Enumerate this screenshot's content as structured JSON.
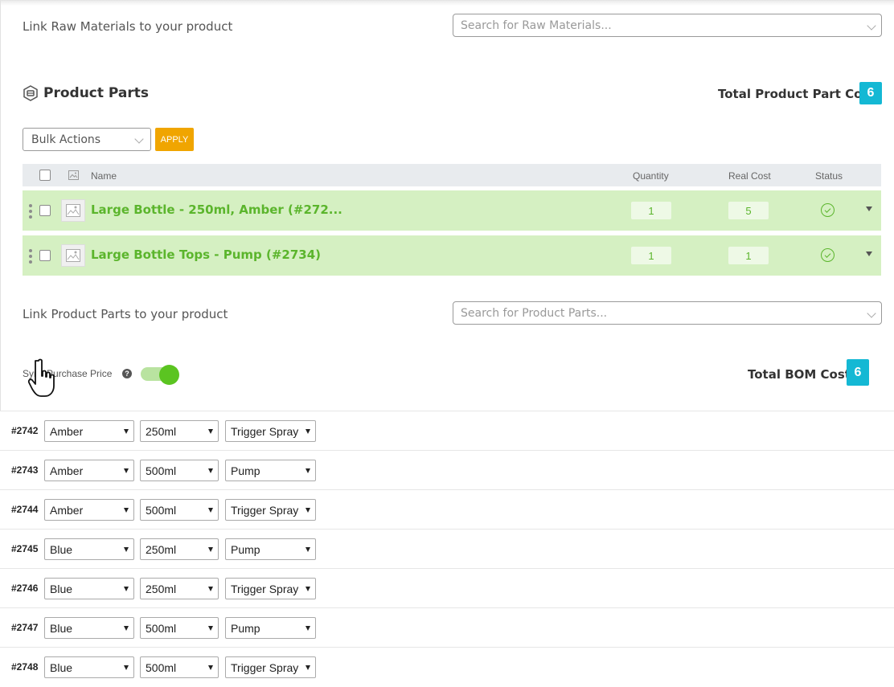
{
  "raw_materials": {
    "label": "Link Raw Materials to your product",
    "search_placeholder": "Search for Raw Materials..."
  },
  "product_parts": {
    "title": "Product Parts",
    "total_label": "Total Product Part Cost",
    "total_value": "6",
    "bulk_actions": "Bulk Actions",
    "apply": "APPLY",
    "columns": {
      "name": "Name",
      "quantity": "Quantity",
      "real_cost": "Real Cost",
      "status": "Status"
    },
    "rows": [
      {
        "name": "Large Bottle - 250ml, Amber (#272...",
        "quantity": "1",
        "real_cost": "5"
      },
      {
        "name": "Large Bottle Tops - Pump (#2734)",
        "quantity": "1",
        "real_cost": "1"
      }
    ],
    "link_label": "Link Product Parts to your product",
    "search_placeholder": "Search for Product Parts..."
  },
  "sync": {
    "label": "Sync Purchase Price",
    "on": true
  },
  "bom": {
    "label": "Total BOM Cost",
    "value": "6"
  },
  "variations": [
    {
      "id": "#2742",
      "color": "Amber",
      "size": "250ml",
      "top": "Trigger Spray"
    },
    {
      "id": "#2743",
      "color": "Amber",
      "size": "500ml",
      "top": "Pump"
    },
    {
      "id": "#2744",
      "color": "Amber",
      "size": "500ml",
      "top": "Trigger Spray"
    },
    {
      "id": "#2745",
      "color": "Blue",
      "size": "250ml",
      "top": "Pump"
    },
    {
      "id": "#2746",
      "color": "Blue",
      "size": "250ml",
      "top": "Trigger Spray"
    },
    {
      "id": "#2747",
      "color": "Blue",
      "size": "500ml",
      "top": "Pump"
    },
    {
      "id": "#2748",
      "color": "Blue",
      "size": "500ml",
      "top": "Trigger Spray"
    }
  ],
  "colors": {
    "accent_green": "#5bb52c",
    "row_green": "#d5f0c2",
    "badge_blue": "#14b8d4",
    "apply_orange": "#f0a500"
  },
  "icons": [
    "box-icon",
    "image-placeholder-icon",
    "drag-handle-icon",
    "check-circle-icon",
    "caret-down-icon",
    "help-icon",
    "hand-cursor-icon"
  ]
}
